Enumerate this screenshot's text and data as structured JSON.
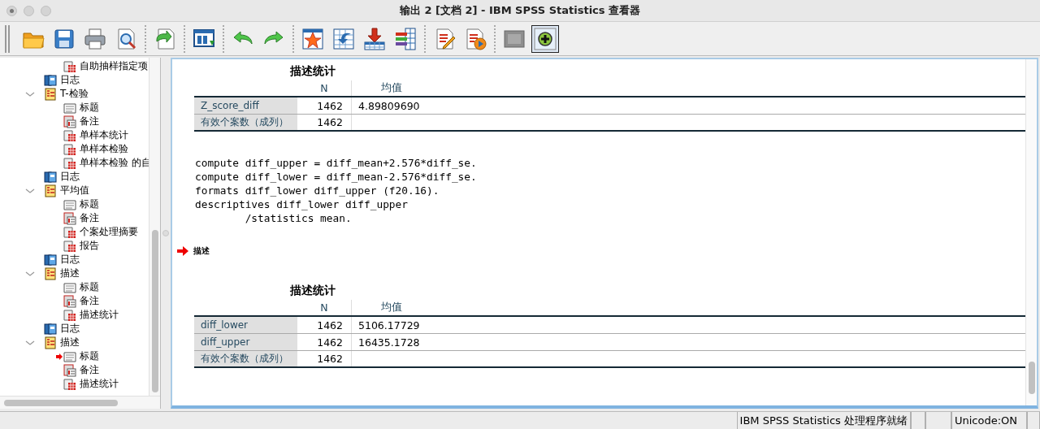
{
  "window": {
    "title": "输出 2 [文档 2] - IBM SPSS Statistics 查看器"
  },
  "toolbar": {
    "groups": [
      [
        {
          "kind": "open",
          "selected": false
        },
        {
          "kind": "save",
          "selected": false
        },
        {
          "kind": "print",
          "selected": false
        },
        {
          "kind": "preview",
          "selected": false
        }
      ],
      [
        {
          "kind": "goto",
          "selected": false
        }
      ],
      [
        {
          "kind": "window",
          "selected": false
        }
      ],
      [
        {
          "kind": "undo",
          "selected": false
        },
        {
          "kind": "redo",
          "selected": false
        }
      ],
      [
        {
          "kind": "star-table",
          "selected": false
        },
        {
          "kind": "table-back",
          "selected": false
        },
        {
          "kind": "insert",
          "selected": false
        },
        {
          "kind": "bars",
          "selected": false
        }
      ],
      [
        {
          "kind": "edit-doc",
          "selected": false
        },
        {
          "kind": "play-doc",
          "selected": false
        }
      ],
      [
        {
          "kind": "grey",
          "selected": false
        },
        {
          "kind": "plus",
          "selected": true
        }
      ]
    ]
  },
  "outline": {
    "continued_items": [
      {
        "label": "自助抽样指定项",
        "kind": "table",
        "current": false
      }
    ],
    "items": [
      {
        "label": "日志",
        "kind": "log"
      },
      {
        "label": "T-检验",
        "kind": "folder",
        "expanded": true,
        "children": [
          {
            "label": "标题",
            "kind": "title",
            "current": false
          },
          {
            "label": "备注",
            "kind": "notes",
            "current": false
          },
          {
            "label": "单样本统计",
            "kind": "table",
            "current": false
          },
          {
            "label": "单样本检验",
            "kind": "table",
            "current": false
          },
          {
            "label": "单样本检验 的自",
            "kind": "table",
            "current": false
          }
        ]
      },
      {
        "label": "日志",
        "kind": "log"
      },
      {
        "label": "平均值",
        "kind": "folder",
        "expanded": true,
        "children": [
          {
            "label": "标题",
            "kind": "title",
            "current": false
          },
          {
            "label": "备注",
            "kind": "notes",
            "current": false
          },
          {
            "label": "个案处理摘要",
            "kind": "table",
            "current": false
          },
          {
            "label": "报告",
            "kind": "table",
            "current": false
          }
        ]
      },
      {
        "label": "日志",
        "kind": "log"
      },
      {
        "label": "描述",
        "kind": "folder",
        "expanded": true,
        "children": [
          {
            "label": "标题",
            "kind": "title",
            "current": false
          },
          {
            "label": "备注",
            "kind": "notes",
            "current": false
          },
          {
            "label": "描述统计",
            "kind": "table",
            "current": false
          }
        ]
      },
      {
        "label": "日志",
        "kind": "log"
      },
      {
        "label": "描述",
        "kind": "folder",
        "expanded": true,
        "children": [
          {
            "label": "标题",
            "kind": "title",
            "current": true
          },
          {
            "label": "备注",
            "kind": "notes",
            "current": false
          },
          {
            "label": "描述统计",
            "kind": "table",
            "current": false
          }
        ]
      }
    ]
  },
  "output": {
    "blocks": [
      {
        "kind": "table",
        "title": "描述统计",
        "columns": [
          "",
          "N",
          "均值"
        ],
        "rows": [
          [
            "Z_score_diff",
            "1462",
            "4.89809690"
          ],
          [
            "有效个案数（成列）",
            "1462"
          ]
        ]
      },
      {
        "kind": "log",
        "lines": [
          "compute diff_upper = diff_mean+2.576*diff_se.",
          "compute diff_lower = diff_mean-2.576*diff_se.",
          "formats diff_lower diff_upper (f20.16).",
          "descriptives diff_lower diff_upper",
          "        /statistics mean."
        ]
      },
      {
        "kind": "heading",
        "text": "描述",
        "current": true
      },
      {
        "kind": "table",
        "title": "描述统计",
        "columns": [
          "",
          "N",
          "均值"
        ],
        "rows": [
          [
            "diff_lower",
            "1462",
            "5106.17729"
          ],
          [
            "diff_upper",
            "1462",
            "16435.1728"
          ],
          [
            "有效个案数（成列）",
            "1462"
          ]
        ]
      }
    ]
  },
  "status_bar": {
    "cells": [
      "IBM SPSS Statistics 处理程序就绪",
      "Unicode:ON"
    ]
  }
}
